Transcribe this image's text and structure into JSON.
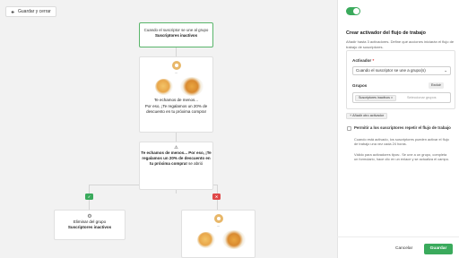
{
  "toolbar": {
    "back_label": "Guardar y cerrar"
  },
  "flow": {
    "trigger": {
      "text": "Cuando el suscriptor se une al grupo",
      "group": "Suscriptores inactivos"
    },
    "email1": {
      "line1": "Te echamos de menos...",
      "line2": "Por eso, ¡Te regalamos un 20% de descuento en tu próxima compra!"
    },
    "condition": {
      "line1": "Te echamos de menos...",
      "line2": "Por eso, ¡Te regalamos un 20% de descuento en tu próxima compra!",
      "suffix": "se abrió"
    },
    "yes_icon": "check-icon",
    "no_icon": "x-icon",
    "remove_action": {
      "text": "Eliminar del grupo",
      "group": "Suscriptores inactivos"
    }
  },
  "panel": {
    "title": "Crear activador del flujo de trabajo",
    "description": "Añadir hasta 3 activadores. Define qué acciones iniciarán el flujo de trabajo de suscriptores.",
    "trigger_label": "Activador",
    "trigger_value": "Cuando el suscriptor se une a grupo(s)",
    "groups_label": "Grupos",
    "exclude_label": "Excluir",
    "selected_group": "Suscriptores inactivos",
    "groups_placeholder": "Seleccionar grupos",
    "add_trigger_label": "+ Añadir otro activador",
    "repeat_label": "Permitir a los suscriptores repetir el flujo de trabajo",
    "repeat_desc1": "Cuando está activado, los suscriptores pueden activar el flujo de trabajo una vez cada 24 horas.",
    "repeat_desc2": "Válido para activadores tipos:. Se une a un grupo, completa un formulario, hace clic en un enlace y se actualiza el campo.",
    "cancel_label": "Cancelar",
    "save_label": "Guardar"
  },
  "colors": {
    "accent": "#3aaa5c",
    "danger": "#e04848"
  }
}
